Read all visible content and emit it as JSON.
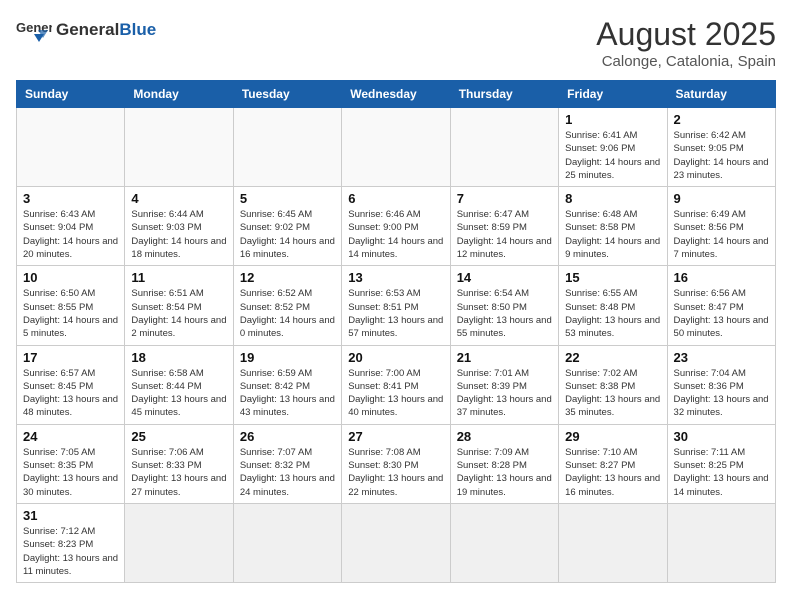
{
  "logo": {
    "text_general": "General",
    "text_blue": "Blue"
  },
  "header": {
    "month": "August 2025",
    "location": "Calonge, Catalonia, Spain"
  },
  "weekdays": [
    "Sunday",
    "Monday",
    "Tuesday",
    "Wednesday",
    "Thursday",
    "Friday",
    "Saturday"
  ],
  "weeks": [
    [
      {
        "day": "",
        "info": ""
      },
      {
        "day": "",
        "info": ""
      },
      {
        "day": "",
        "info": ""
      },
      {
        "day": "",
        "info": ""
      },
      {
        "day": "",
        "info": ""
      },
      {
        "day": "1",
        "info": "Sunrise: 6:41 AM\nSunset: 9:06 PM\nDaylight: 14 hours and 25 minutes."
      },
      {
        "day": "2",
        "info": "Sunrise: 6:42 AM\nSunset: 9:05 PM\nDaylight: 14 hours and 23 minutes."
      }
    ],
    [
      {
        "day": "3",
        "info": "Sunrise: 6:43 AM\nSunset: 9:04 PM\nDaylight: 14 hours and 20 minutes."
      },
      {
        "day": "4",
        "info": "Sunrise: 6:44 AM\nSunset: 9:03 PM\nDaylight: 14 hours and 18 minutes."
      },
      {
        "day": "5",
        "info": "Sunrise: 6:45 AM\nSunset: 9:02 PM\nDaylight: 14 hours and 16 minutes."
      },
      {
        "day": "6",
        "info": "Sunrise: 6:46 AM\nSunset: 9:00 PM\nDaylight: 14 hours and 14 minutes."
      },
      {
        "day": "7",
        "info": "Sunrise: 6:47 AM\nSunset: 8:59 PM\nDaylight: 14 hours and 12 minutes."
      },
      {
        "day": "8",
        "info": "Sunrise: 6:48 AM\nSunset: 8:58 PM\nDaylight: 14 hours and 9 minutes."
      },
      {
        "day": "9",
        "info": "Sunrise: 6:49 AM\nSunset: 8:56 PM\nDaylight: 14 hours and 7 minutes."
      }
    ],
    [
      {
        "day": "10",
        "info": "Sunrise: 6:50 AM\nSunset: 8:55 PM\nDaylight: 14 hours and 5 minutes."
      },
      {
        "day": "11",
        "info": "Sunrise: 6:51 AM\nSunset: 8:54 PM\nDaylight: 14 hours and 2 minutes."
      },
      {
        "day": "12",
        "info": "Sunrise: 6:52 AM\nSunset: 8:52 PM\nDaylight: 14 hours and 0 minutes."
      },
      {
        "day": "13",
        "info": "Sunrise: 6:53 AM\nSunset: 8:51 PM\nDaylight: 13 hours and 57 minutes."
      },
      {
        "day": "14",
        "info": "Sunrise: 6:54 AM\nSunset: 8:50 PM\nDaylight: 13 hours and 55 minutes."
      },
      {
        "day": "15",
        "info": "Sunrise: 6:55 AM\nSunset: 8:48 PM\nDaylight: 13 hours and 53 minutes."
      },
      {
        "day": "16",
        "info": "Sunrise: 6:56 AM\nSunset: 8:47 PM\nDaylight: 13 hours and 50 minutes."
      }
    ],
    [
      {
        "day": "17",
        "info": "Sunrise: 6:57 AM\nSunset: 8:45 PM\nDaylight: 13 hours and 48 minutes."
      },
      {
        "day": "18",
        "info": "Sunrise: 6:58 AM\nSunset: 8:44 PM\nDaylight: 13 hours and 45 minutes."
      },
      {
        "day": "19",
        "info": "Sunrise: 6:59 AM\nSunset: 8:42 PM\nDaylight: 13 hours and 43 minutes."
      },
      {
        "day": "20",
        "info": "Sunrise: 7:00 AM\nSunset: 8:41 PM\nDaylight: 13 hours and 40 minutes."
      },
      {
        "day": "21",
        "info": "Sunrise: 7:01 AM\nSunset: 8:39 PM\nDaylight: 13 hours and 37 minutes."
      },
      {
        "day": "22",
        "info": "Sunrise: 7:02 AM\nSunset: 8:38 PM\nDaylight: 13 hours and 35 minutes."
      },
      {
        "day": "23",
        "info": "Sunrise: 7:04 AM\nSunset: 8:36 PM\nDaylight: 13 hours and 32 minutes."
      }
    ],
    [
      {
        "day": "24",
        "info": "Sunrise: 7:05 AM\nSunset: 8:35 PM\nDaylight: 13 hours and 30 minutes."
      },
      {
        "day": "25",
        "info": "Sunrise: 7:06 AM\nSunset: 8:33 PM\nDaylight: 13 hours and 27 minutes."
      },
      {
        "day": "26",
        "info": "Sunrise: 7:07 AM\nSunset: 8:32 PM\nDaylight: 13 hours and 24 minutes."
      },
      {
        "day": "27",
        "info": "Sunrise: 7:08 AM\nSunset: 8:30 PM\nDaylight: 13 hours and 22 minutes."
      },
      {
        "day": "28",
        "info": "Sunrise: 7:09 AM\nSunset: 8:28 PM\nDaylight: 13 hours and 19 minutes."
      },
      {
        "day": "29",
        "info": "Sunrise: 7:10 AM\nSunset: 8:27 PM\nDaylight: 13 hours and 16 minutes."
      },
      {
        "day": "30",
        "info": "Sunrise: 7:11 AM\nSunset: 8:25 PM\nDaylight: 13 hours and 14 minutes."
      }
    ],
    [
      {
        "day": "31",
        "info": "Sunrise: 7:12 AM\nSunset: 8:23 PM\nDaylight: 13 hours and 11 minutes."
      },
      {
        "day": "",
        "info": ""
      },
      {
        "day": "",
        "info": ""
      },
      {
        "day": "",
        "info": ""
      },
      {
        "day": "",
        "info": ""
      },
      {
        "day": "",
        "info": ""
      },
      {
        "day": "",
        "info": ""
      }
    ]
  ]
}
